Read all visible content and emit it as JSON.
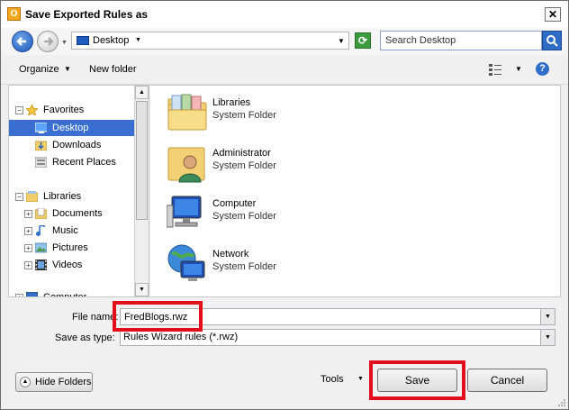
{
  "window": {
    "title": "Save Exported Rules as",
    "app_icon_letter": "O"
  },
  "navbar": {
    "location": "Desktop",
    "search_placeholder": "Search Desktop"
  },
  "toolbar": {
    "organize_label": "Organize",
    "new_folder_label": "New folder"
  },
  "sidebar": {
    "items": [
      {
        "label": "Favorites",
        "icon": "star-icon",
        "expander": "−"
      },
      {
        "label": "Desktop",
        "icon": "desktop-icon",
        "selected": true
      },
      {
        "label": "Downloads",
        "icon": "downloads-icon"
      },
      {
        "label": "Recent Places",
        "icon": "recent-places-icon"
      },
      {
        "label": "Libraries",
        "icon": "libraries-icon",
        "expander": "−"
      },
      {
        "label": "Documents",
        "icon": "documents-icon",
        "expander": "+"
      },
      {
        "label": "Music",
        "icon": "music-icon",
        "expander": "+"
      },
      {
        "label": "Pictures",
        "icon": "pictures-icon",
        "expander": "+"
      },
      {
        "label": "Videos",
        "icon": "videos-icon",
        "expander": "+"
      },
      {
        "label": "Computer",
        "icon": "computer-icon",
        "expander": "+"
      }
    ]
  },
  "files": [
    {
      "name": "Libraries",
      "type": "System Folder",
      "icon": "libraries-folder-icon"
    },
    {
      "name": "Administrator",
      "type": "System Folder",
      "icon": "user-folder-icon"
    },
    {
      "name": "Computer",
      "type": "System Folder",
      "icon": "computer-icon"
    },
    {
      "name": "Network",
      "type": "System Folder",
      "icon": "network-icon"
    }
  ],
  "form": {
    "file_name_label": "File name:",
    "file_name_value": "FredBlogs.rwz",
    "save_type_label": "Save as type:",
    "save_type_value": "Rules Wizard rules (*.rwz)"
  },
  "buttons": {
    "hide_folders": "Hide Folders",
    "tools": "Tools",
    "save": "Save",
    "cancel": "Cancel"
  },
  "colors": {
    "highlight_red": "#e30e1b",
    "selection_blue": "#3a6fd1"
  }
}
